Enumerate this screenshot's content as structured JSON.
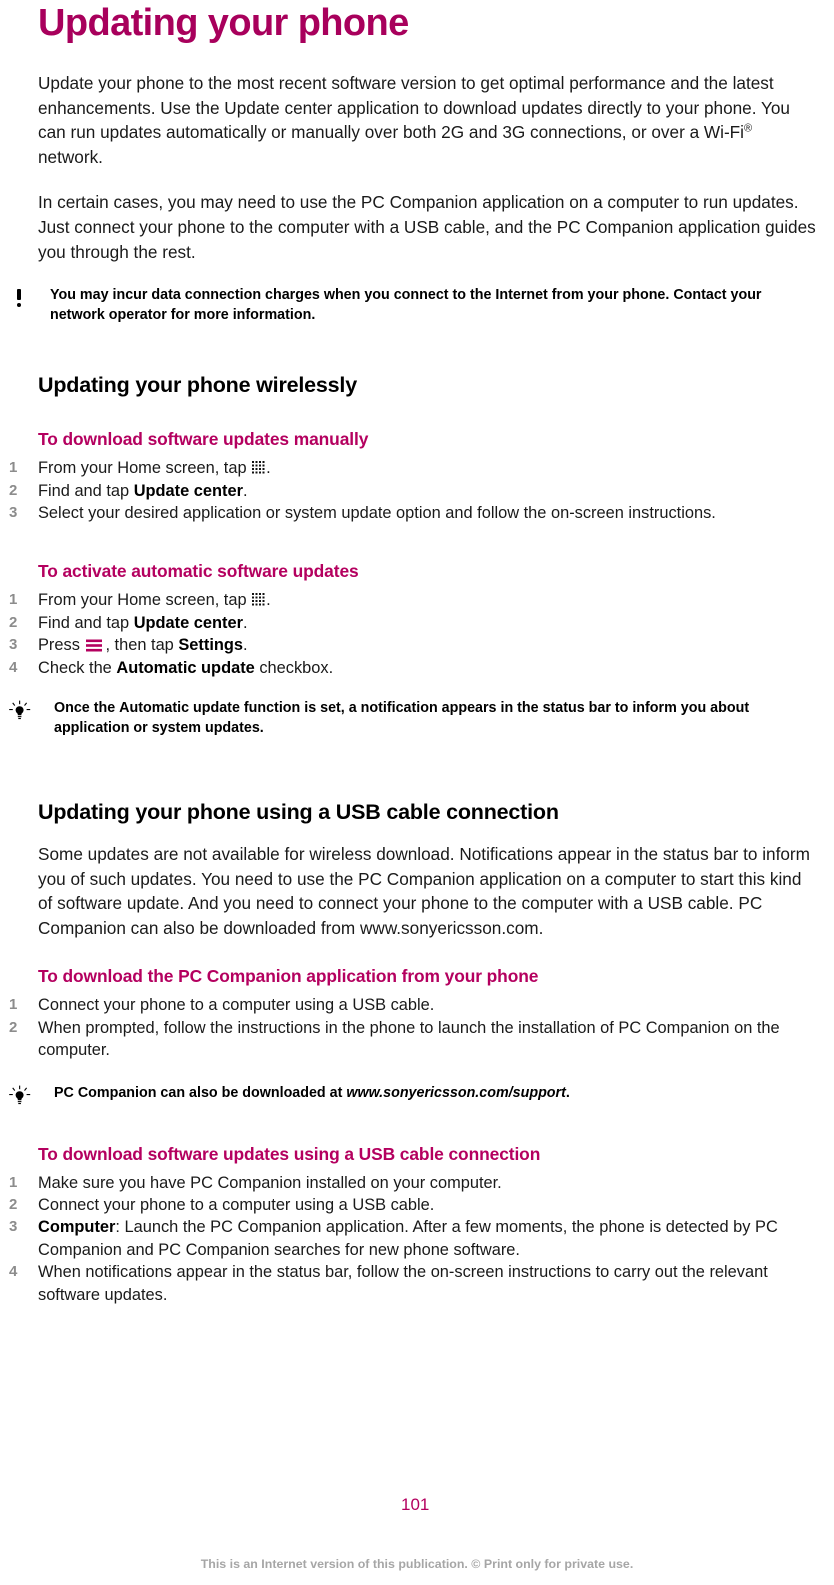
{
  "document": {
    "chapter_title": "Updating your phone",
    "page_number": "101",
    "footer_note": "This is an Internet version of this publication. © Print only for private use."
  },
  "colors": {
    "accent_magenta": "#b4005f",
    "title_magenta": "#a8005c",
    "step_number_gray": "#8c8c8c",
    "footer_gray": "#a6a6a6",
    "body_black": "#1a1a1a"
  },
  "intro": {
    "paragraph_1_part1": "Update your phone to the most recent software version to get optimal performance and the latest enhancements. Use the Update center application to download updates directly to your phone. You can run updates automatically or manually over both 2G and 3G connections, or over a Wi-Fi",
    "paragraph_1_superscript": "®",
    "paragraph_1_part2": " network.",
    "paragraph_2": "In certain cases, you may need to use the PC Companion application on a computer to run updates. Just connect your phone to the computer with a USB cable, and the PC Companion application guides you through the rest."
  },
  "note_data_charges": {
    "icon": "exclamation-icon",
    "text": "You may incur data connection charges when you connect to the Internet from your phone. Contact your network operator for more information."
  },
  "section_wireless": {
    "heading": "Updating your phone wirelessly",
    "task_manual": {
      "heading": "To download software updates manually",
      "steps": [
        {
          "num": "1",
          "before_icon": "From your Home screen, tap ",
          "icon": "grid-icon",
          "after_icon": "."
        },
        {
          "num": "2",
          "text_pre": "Find and tap ",
          "bold": "Update center",
          "text_post": "."
        },
        {
          "num": "3",
          "text": "Select your desired application or system update option and follow the on-screen instructions."
        }
      ]
    },
    "task_automatic": {
      "heading": "To activate automatic software updates",
      "steps": [
        {
          "num": "1",
          "before_icon": "From your Home screen, tap ",
          "icon": "grid-icon",
          "after_icon": "."
        },
        {
          "num": "2",
          "text_pre": "Find and tap ",
          "bold": "Update center",
          "text_post": "."
        },
        {
          "num": "3",
          "before_icon": "Press ",
          "icon": "menu-icon",
          "after_icon": ", then tap ",
          "bold": "Settings",
          "text_post": "."
        },
        {
          "num": "4",
          "text_pre": "Check the ",
          "bold": "Automatic update",
          "text_post": " checkbox."
        }
      ]
    },
    "tip": {
      "icon": "lightbulb-icon",
      "text_pre": "Once the ",
      "bold": "Automatic update",
      "text_post": " function is set, a notification appears in the status bar to inform you about application or system updates."
    }
  },
  "section_usb": {
    "heading": "Updating your phone using a USB cable connection",
    "paragraph": "Some updates are not available for wireless download. Notifications appear in the status bar to inform you of such updates. You need to use the PC Companion application on a computer to start this kind of software update. And you need to connect your phone to the computer with a USB cable. PC Companion can also be downloaded from www.sonyericsson.com.",
    "task_download_pcc": {
      "heading": "To download the PC Companion application from your phone",
      "steps": [
        {
          "num": "1",
          "text": "Connect your phone to a computer using a USB cable."
        },
        {
          "num": "2",
          "text": "When prompted, follow the instructions in the phone to launch the installation of PC Companion on the computer."
        }
      ]
    },
    "tip": {
      "icon": "lightbulb-icon",
      "text_pre": "PC Companion can also be downloaded at ",
      "italic": "www.sonyericsson.com/support",
      "text_post": "."
    },
    "task_updates_usb": {
      "heading": "To download software updates using a USB cable connection",
      "steps": [
        {
          "num": "1",
          "text": "Make sure you have PC Companion installed on your computer."
        },
        {
          "num": "2",
          "text": "Connect your phone to a computer using a USB cable."
        },
        {
          "num": "3",
          "bold": "Computer",
          "text_post": ": Launch the PC Companion application. After a few moments, the phone is detected by PC Companion and PC Companion searches for new phone software."
        },
        {
          "num": "4",
          "text": "When notifications appear in the status bar, follow the on-screen instructions to carry out the relevant software updates."
        }
      ]
    }
  }
}
